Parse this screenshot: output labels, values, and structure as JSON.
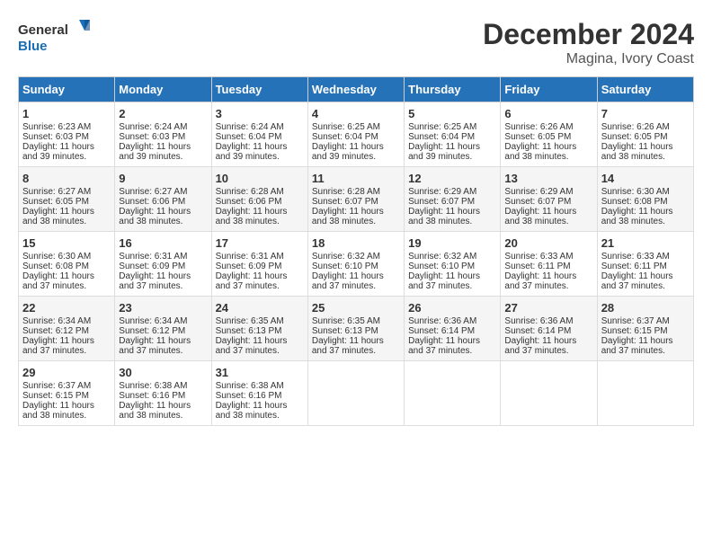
{
  "header": {
    "logo_line1": "General",
    "logo_line2": "Blue",
    "month": "December 2024",
    "location": "Magina, Ivory Coast"
  },
  "days_of_week": [
    "Sunday",
    "Monday",
    "Tuesday",
    "Wednesday",
    "Thursday",
    "Friday",
    "Saturday"
  ],
  "weeks": [
    [
      {
        "day": "1",
        "lines": [
          "Sunrise: 6:23 AM",
          "Sunset: 6:03 PM",
          "Daylight: 11 hours",
          "and 39 minutes."
        ]
      },
      {
        "day": "2",
        "lines": [
          "Sunrise: 6:24 AM",
          "Sunset: 6:03 PM",
          "Daylight: 11 hours",
          "and 39 minutes."
        ]
      },
      {
        "day": "3",
        "lines": [
          "Sunrise: 6:24 AM",
          "Sunset: 6:04 PM",
          "Daylight: 11 hours",
          "and 39 minutes."
        ]
      },
      {
        "day": "4",
        "lines": [
          "Sunrise: 6:25 AM",
          "Sunset: 6:04 PM",
          "Daylight: 11 hours",
          "and 39 minutes."
        ]
      },
      {
        "day": "5",
        "lines": [
          "Sunrise: 6:25 AM",
          "Sunset: 6:04 PM",
          "Daylight: 11 hours",
          "and 39 minutes."
        ]
      },
      {
        "day": "6",
        "lines": [
          "Sunrise: 6:26 AM",
          "Sunset: 6:05 PM",
          "Daylight: 11 hours",
          "and 38 minutes."
        ]
      },
      {
        "day": "7",
        "lines": [
          "Sunrise: 6:26 AM",
          "Sunset: 6:05 PM",
          "Daylight: 11 hours",
          "and 38 minutes."
        ]
      }
    ],
    [
      {
        "day": "8",
        "lines": [
          "Sunrise: 6:27 AM",
          "Sunset: 6:05 PM",
          "Daylight: 11 hours",
          "and 38 minutes."
        ]
      },
      {
        "day": "9",
        "lines": [
          "Sunrise: 6:27 AM",
          "Sunset: 6:06 PM",
          "Daylight: 11 hours",
          "and 38 minutes."
        ]
      },
      {
        "day": "10",
        "lines": [
          "Sunrise: 6:28 AM",
          "Sunset: 6:06 PM",
          "Daylight: 11 hours",
          "and 38 minutes."
        ]
      },
      {
        "day": "11",
        "lines": [
          "Sunrise: 6:28 AM",
          "Sunset: 6:07 PM",
          "Daylight: 11 hours",
          "and 38 minutes."
        ]
      },
      {
        "day": "12",
        "lines": [
          "Sunrise: 6:29 AM",
          "Sunset: 6:07 PM",
          "Daylight: 11 hours",
          "and 38 minutes."
        ]
      },
      {
        "day": "13",
        "lines": [
          "Sunrise: 6:29 AM",
          "Sunset: 6:07 PM",
          "Daylight: 11 hours",
          "and 38 minutes."
        ]
      },
      {
        "day": "14",
        "lines": [
          "Sunrise: 6:30 AM",
          "Sunset: 6:08 PM",
          "Daylight: 11 hours",
          "and 38 minutes."
        ]
      }
    ],
    [
      {
        "day": "15",
        "lines": [
          "Sunrise: 6:30 AM",
          "Sunset: 6:08 PM",
          "Daylight: 11 hours",
          "and 37 minutes."
        ]
      },
      {
        "day": "16",
        "lines": [
          "Sunrise: 6:31 AM",
          "Sunset: 6:09 PM",
          "Daylight: 11 hours",
          "and 37 minutes."
        ]
      },
      {
        "day": "17",
        "lines": [
          "Sunrise: 6:31 AM",
          "Sunset: 6:09 PM",
          "Daylight: 11 hours",
          "and 37 minutes."
        ]
      },
      {
        "day": "18",
        "lines": [
          "Sunrise: 6:32 AM",
          "Sunset: 6:10 PM",
          "Daylight: 11 hours",
          "and 37 minutes."
        ]
      },
      {
        "day": "19",
        "lines": [
          "Sunrise: 6:32 AM",
          "Sunset: 6:10 PM",
          "Daylight: 11 hours",
          "and 37 minutes."
        ]
      },
      {
        "day": "20",
        "lines": [
          "Sunrise: 6:33 AM",
          "Sunset: 6:11 PM",
          "Daylight: 11 hours",
          "and 37 minutes."
        ]
      },
      {
        "day": "21",
        "lines": [
          "Sunrise: 6:33 AM",
          "Sunset: 6:11 PM",
          "Daylight: 11 hours",
          "and 37 minutes."
        ]
      }
    ],
    [
      {
        "day": "22",
        "lines": [
          "Sunrise: 6:34 AM",
          "Sunset: 6:12 PM",
          "Daylight: 11 hours",
          "and 37 minutes."
        ]
      },
      {
        "day": "23",
        "lines": [
          "Sunrise: 6:34 AM",
          "Sunset: 6:12 PM",
          "Daylight: 11 hours",
          "and 37 minutes."
        ]
      },
      {
        "day": "24",
        "lines": [
          "Sunrise: 6:35 AM",
          "Sunset: 6:13 PM",
          "Daylight: 11 hours",
          "and 37 minutes."
        ]
      },
      {
        "day": "25",
        "lines": [
          "Sunrise: 6:35 AM",
          "Sunset: 6:13 PM",
          "Daylight: 11 hours",
          "and 37 minutes."
        ]
      },
      {
        "day": "26",
        "lines": [
          "Sunrise: 6:36 AM",
          "Sunset: 6:14 PM",
          "Daylight: 11 hours",
          "and 37 minutes."
        ]
      },
      {
        "day": "27",
        "lines": [
          "Sunrise: 6:36 AM",
          "Sunset: 6:14 PM",
          "Daylight: 11 hours",
          "and 37 minutes."
        ]
      },
      {
        "day": "28",
        "lines": [
          "Sunrise: 6:37 AM",
          "Sunset: 6:15 PM",
          "Daylight: 11 hours",
          "and 37 minutes."
        ]
      }
    ],
    [
      {
        "day": "29",
        "lines": [
          "Sunrise: 6:37 AM",
          "Sunset: 6:15 PM",
          "Daylight: 11 hours",
          "and 38 minutes."
        ]
      },
      {
        "day": "30",
        "lines": [
          "Sunrise: 6:38 AM",
          "Sunset: 6:16 PM",
          "Daylight: 11 hours",
          "and 38 minutes."
        ]
      },
      {
        "day": "31",
        "lines": [
          "Sunrise: 6:38 AM",
          "Sunset: 6:16 PM",
          "Daylight: 11 hours",
          "and 38 minutes."
        ]
      },
      {
        "day": "",
        "lines": []
      },
      {
        "day": "",
        "lines": []
      },
      {
        "day": "",
        "lines": []
      },
      {
        "day": "",
        "lines": []
      }
    ]
  ]
}
